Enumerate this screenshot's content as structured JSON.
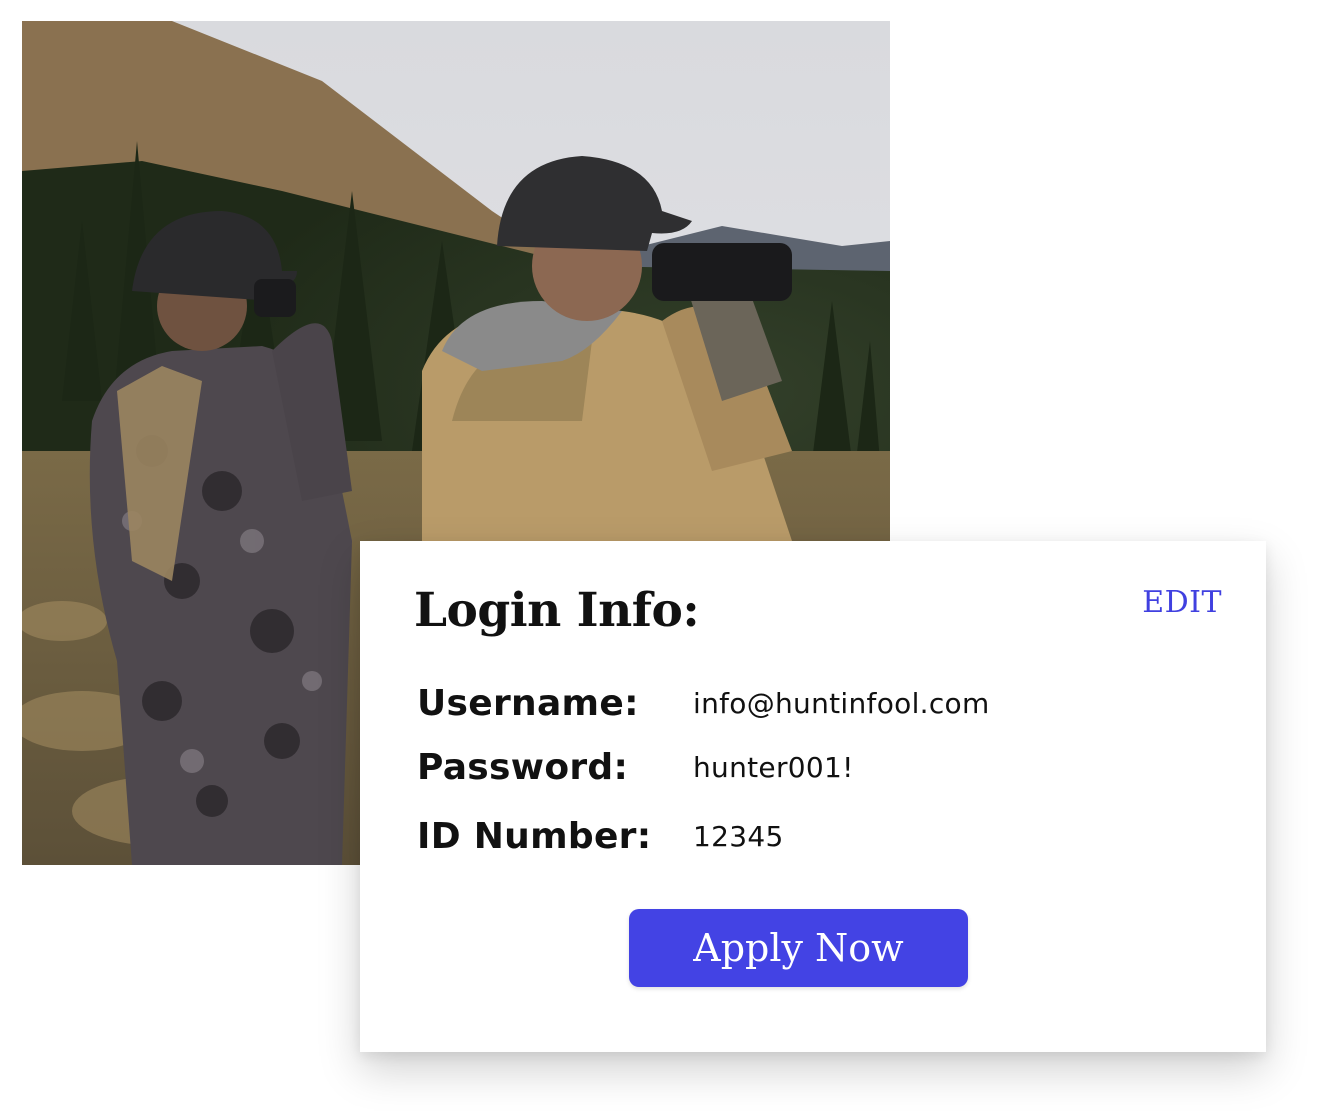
{
  "photo": {
    "description_icon": "hunters-binoculars-photo",
    "colors": {
      "sky": "#dcdde2",
      "hillside": "#8a7150",
      "forest": "#27331f",
      "jacket_tan": "#b99b69",
      "camo": "#4d474d"
    }
  },
  "login_card": {
    "title": "Login Info:",
    "edit_label": "EDIT",
    "fields": [
      {
        "label": "Username:",
        "value": "info@huntinfool.com"
      },
      {
        "label": "Password:",
        "value": "hunter001!"
      },
      {
        "label": "ID Number:",
        "value": "12345"
      }
    ],
    "apply_label": "Apply Now"
  },
  "colors": {
    "accent": "#4343e4",
    "edit_link": "#4040e0",
    "text": "#111111",
    "card_bg": "#ffffff"
  }
}
